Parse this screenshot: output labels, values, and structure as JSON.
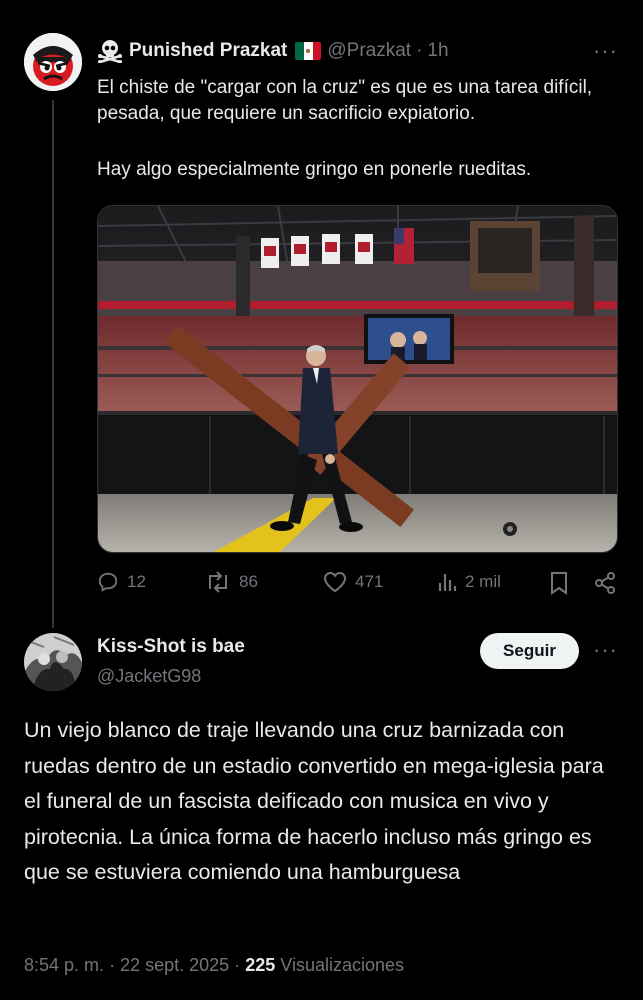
{
  "tweet": {
    "author_name": "Punished Prazkat",
    "author_handle": "@Prazkat",
    "separator": "·",
    "time_ago": "1h",
    "text_line1": "El chiste de \"cargar con la cruz\" es que es una tarea difícil, pesada, que requiere un sacrificio expiatorio.",
    "text_line2": "Hay algo especialmente gringo en ponerle rueditas.",
    "flag_colors": [
      "#006847",
      "#ffffff",
      "#ce1126"
    ],
    "stats": {
      "replies": "12",
      "reposts": "86",
      "likes": "471",
      "views": "2 mil"
    },
    "icons": [
      "skull-crossbones-icon",
      "mexico-flag-icon",
      "reply-icon",
      "repost-icon",
      "like-icon",
      "views-icon",
      "bookmark-icon",
      "share-icon",
      "more-icon"
    ]
  },
  "reply": {
    "author_name": "Kiss-Shot is bae",
    "author_handle": "@JacketG98",
    "follow_label": "Seguir",
    "text": "Un viejo blanco de traje llevando una cruz barnizada con ruedas dentro de un estadio convertido en mega-iglesia para el funeral de un fascista deificado con musica en vivo y pirotecnia. La única forma de hacerlo incluso más gringo es que se estuviera comiendo una hamburguesa",
    "time": "8:54 p. m.",
    "separator": "·",
    "date": "22 sept. 2025",
    "separator2": "·",
    "views_count": "225",
    "views_label": "Visualizaciones"
  },
  "colors": {
    "background": "#000000",
    "text": "#e7e9ea",
    "muted": "#71767b",
    "follow_bg": "#eff3f4",
    "stadium_red": "#b01e2e"
  }
}
